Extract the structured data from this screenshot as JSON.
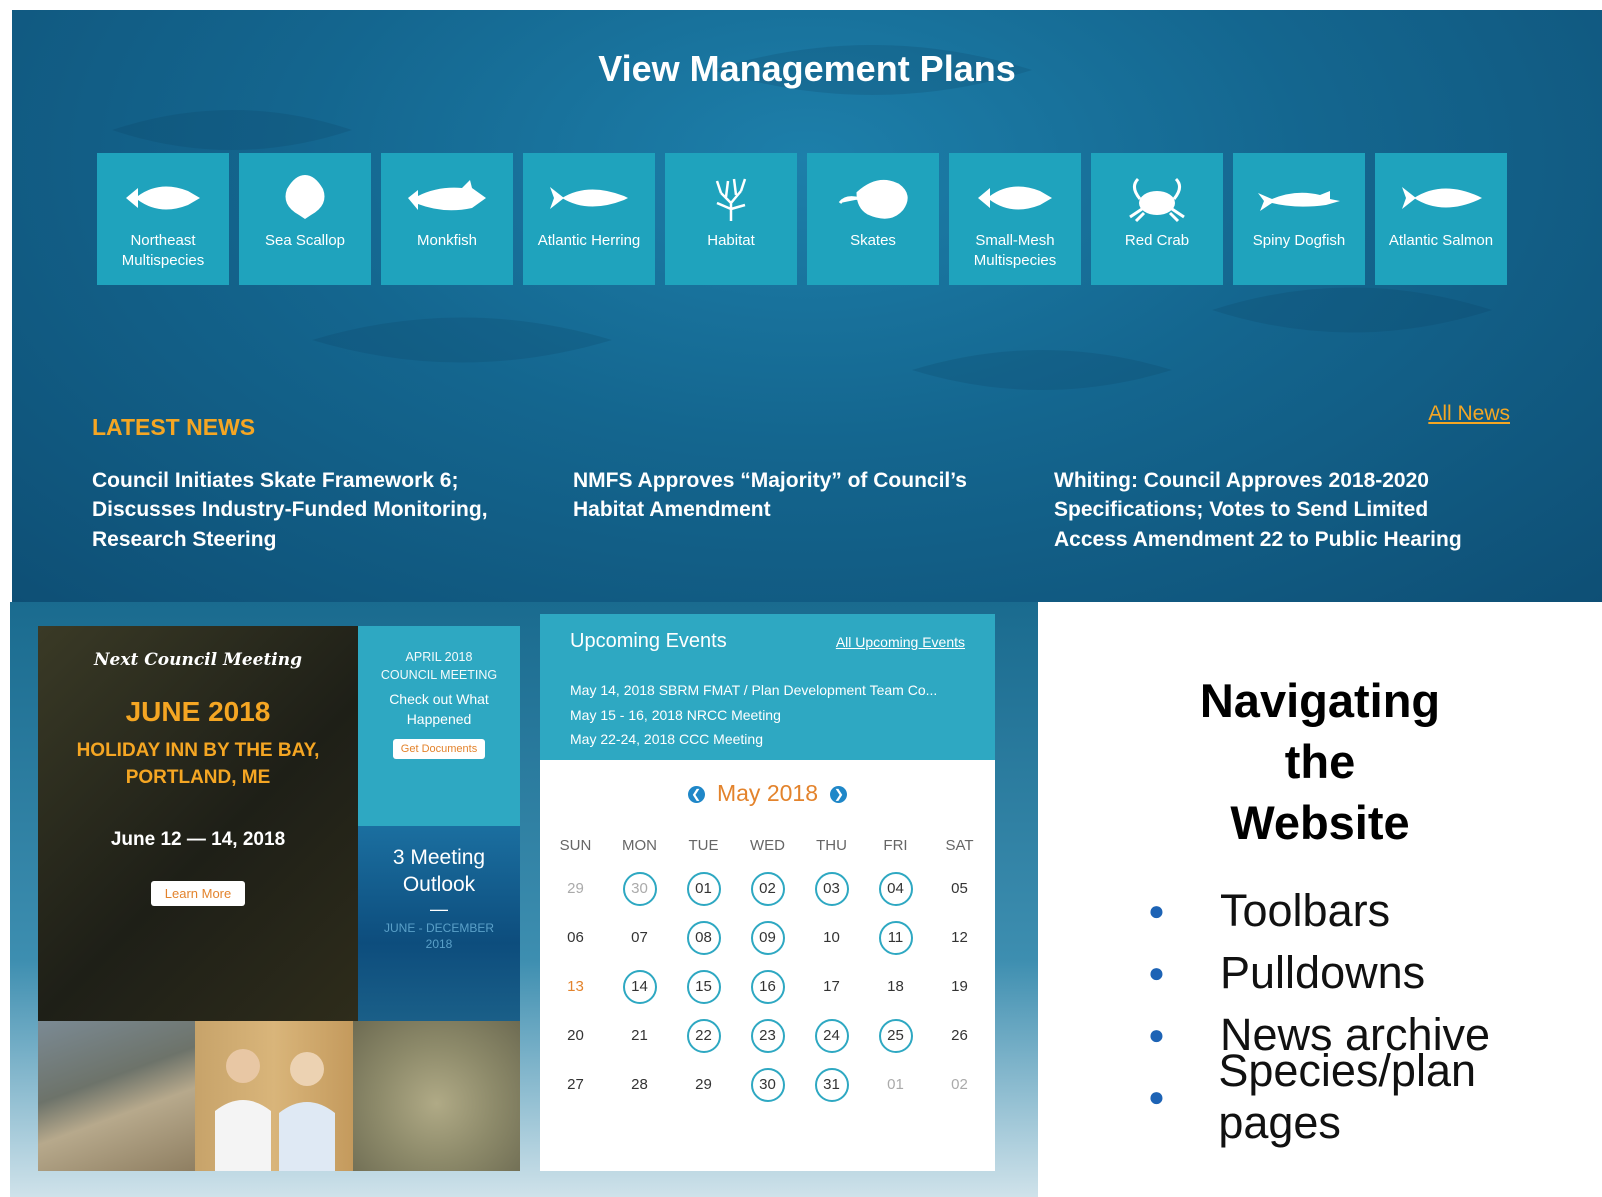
{
  "header": {
    "title": "View Management Plans"
  },
  "species": [
    {
      "label": "Northeast Multispecies",
      "icon": "fish-icon"
    },
    {
      "label": "Sea Scallop",
      "icon": "scallop-icon"
    },
    {
      "label": "Monkfish",
      "icon": "monkfish-icon"
    },
    {
      "label": "Atlantic Herring",
      "icon": "herring-icon"
    },
    {
      "label": "Habitat",
      "icon": "coral-icon"
    },
    {
      "label": "Skates",
      "icon": "skate-icon"
    },
    {
      "label": "Small-Mesh Multispecies",
      "icon": "fish-icon"
    },
    {
      "label": "Red Crab",
      "icon": "crab-icon"
    },
    {
      "label": "Spiny Dogfish",
      "icon": "shark-icon"
    },
    {
      "label": "Atlantic Salmon",
      "icon": "salmon-icon"
    }
  ],
  "news": {
    "heading": "LATEST NEWS",
    "all_link": "All News",
    "items": [
      "Council Initiates Skate Framework 6; Discusses Industry-Funded Monitoring, Research Steering",
      "NMFS Approves “Majority” of Council’s Habitat Amendment",
      "Whiting: Council Approves 2018-2020 Specifications; Votes to Send Limited Access Amendment 22 to Public Hearing"
    ]
  },
  "meeting": {
    "label": "Next Council Meeting",
    "month": "JUNE 2018",
    "venue_line1": "HOLIDAY INN BY THE BAY,",
    "venue_line2": "PORTLAND, ME",
    "dates": "June 12 — 14, 2018",
    "button": "Learn More"
  },
  "april": {
    "caption_line1": "APRIL 2018",
    "caption_line2": "COUNCIL MEETING",
    "sub_line1": "Check out What",
    "sub_line2": "Happened",
    "button": "Get Documents"
  },
  "outlook": {
    "title_line1": "3 Meeting",
    "title_line2": "Outlook",
    "dash": "—",
    "range_line1": "JUNE - DECEMBER",
    "range_line2": "2018"
  },
  "events": {
    "title": "Upcoming Events",
    "all_link": "All Upcoming Events",
    "items": [
      "May 14, 2018 SBRM FMAT / Plan Development Team Co...",
      "May 15 - 16, 2018 NRCC Meeting",
      "May 22-24, 2018 CCC Meeting"
    ]
  },
  "calendar": {
    "month": "May 2018",
    "days_of_week": [
      "SUN",
      "MON",
      "TUE",
      "WED",
      "THU",
      "FRI",
      "SAT"
    ],
    "weeks": [
      [
        {
          "d": "29",
          "muted": true
        },
        {
          "d": "30",
          "muted": true,
          "event": true
        },
        {
          "d": "01",
          "event": true
        },
        {
          "d": "02",
          "event": true
        },
        {
          "d": "03",
          "event": true
        },
        {
          "d": "04",
          "event": true
        },
        {
          "d": "05"
        }
      ],
      [
        {
          "d": "06"
        },
        {
          "d": "07"
        },
        {
          "d": "08",
          "event": true
        },
        {
          "d": "09",
          "event": true
        },
        {
          "d": "10"
        },
        {
          "d": "11",
          "event": true
        },
        {
          "d": "12"
        }
      ],
      [
        {
          "d": "13",
          "today": true
        },
        {
          "d": "14",
          "event": true
        },
        {
          "d": "15",
          "event": true
        },
        {
          "d": "16",
          "event": true
        },
        {
          "d": "17"
        },
        {
          "d": "18"
        },
        {
          "d": "19"
        }
      ],
      [
        {
          "d": "20"
        },
        {
          "d": "21"
        },
        {
          "d": "22",
          "event": true
        },
        {
          "d": "23",
          "event": true
        },
        {
          "d": "24",
          "event": true
        },
        {
          "d": "25",
          "event": true
        },
        {
          "d": "26"
        }
      ],
      [
        {
          "d": "27"
        },
        {
          "d": "28"
        },
        {
          "d": "29"
        },
        {
          "d": "30",
          "event": true
        },
        {
          "d": "31",
          "event": true
        },
        {
          "d": "01",
          "muted": true
        },
        {
          "d": "02",
          "muted": true
        }
      ]
    ]
  },
  "slide": {
    "title_line1": "Navigating",
    "title_line2": "the",
    "title_line3": "Website",
    "bullets": [
      "Toolbars",
      "Pulldowns",
      "News archive",
      "Species/plan pages"
    ]
  },
  "colors": {
    "accent": "#f5a623",
    "tile": "#1fa3bd",
    "events": "#2ea8c2",
    "bullet": "#1d63b5"
  }
}
